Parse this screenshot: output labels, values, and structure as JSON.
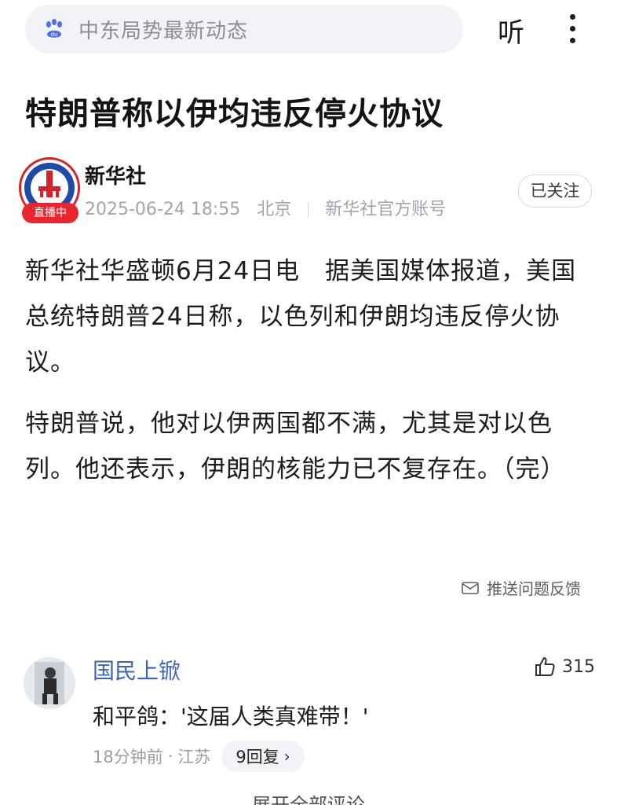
{
  "search": {
    "placeholder": "中东局势最新动态"
  },
  "header": {
    "listen_label": "听"
  },
  "article": {
    "title": "特朗普称以伊均违反停火协议",
    "author": {
      "name": "新华社",
      "badge": "直播中",
      "time": "2025-06-24 18:55",
      "location": "北京",
      "account_type": "新华社官方账号",
      "follow_label": "已关注"
    },
    "paragraphs": [
      "新华社华盛顿6月24日电　据美国媒体报道，美国总统特朗普24日称，以色列和伊朗均违反停火协议。",
      "特朗普说，他对以伊两国都不满，尤其是对以色列。他还表示，伊朗的核能力已不复存在。（完）"
    ],
    "feedback_label": "推送问题反馈"
  },
  "comment": {
    "user": "国民上锨",
    "likes": "315",
    "text": "和平鸽：'这届人类真难带！'",
    "time": "18分钟前",
    "region": "江苏",
    "replies_label": "9回复"
  },
  "expand_label": "展开全部评论"
}
